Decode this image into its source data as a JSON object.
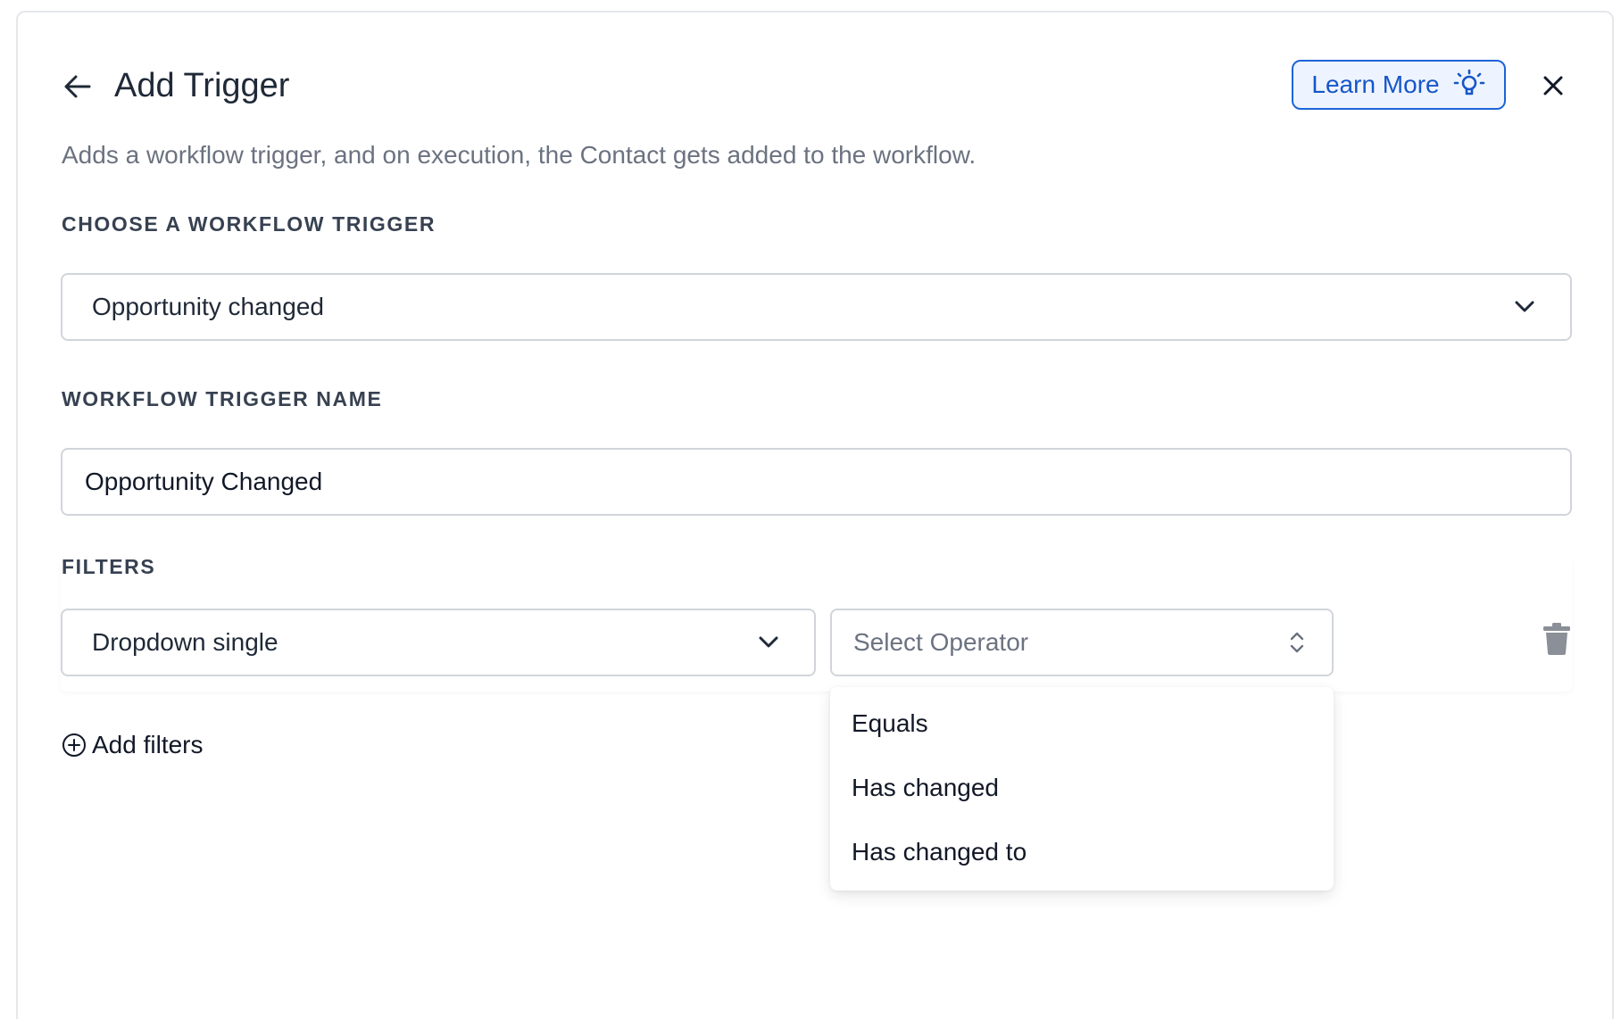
{
  "header": {
    "title": "Add Trigger",
    "learn_more_label": "Learn More",
    "description": "Adds a workflow trigger, and on execution, the Contact gets added to the workflow."
  },
  "trigger_select": {
    "label": "CHOOSE A WORKFLOW TRIGGER",
    "value": "Opportunity changed"
  },
  "trigger_name": {
    "label": "WORKFLOW TRIGGER NAME",
    "value": "Opportunity Changed"
  },
  "filters": {
    "label": "FILTERS",
    "field_value": "Dropdown single",
    "operator_placeholder": "Select Operator",
    "operator_options": [
      "Equals",
      "Has changed",
      "Has changed to"
    ],
    "add_label": "Add filters"
  },
  "colors": {
    "accent": "#1d64d8",
    "label": "#374151",
    "muted": "#6b7280",
    "trash": "#8b8f97"
  },
  "icons": {
    "back": "arrow-left-icon",
    "learn_more": "lightbulb-icon",
    "close": "close-icon",
    "chevron": "chevron-down-icon",
    "operator_chevron": "chevron-up-down-icon",
    "trash": "trash-icon",
    "add": "plus-circle-icon"
  }
}
